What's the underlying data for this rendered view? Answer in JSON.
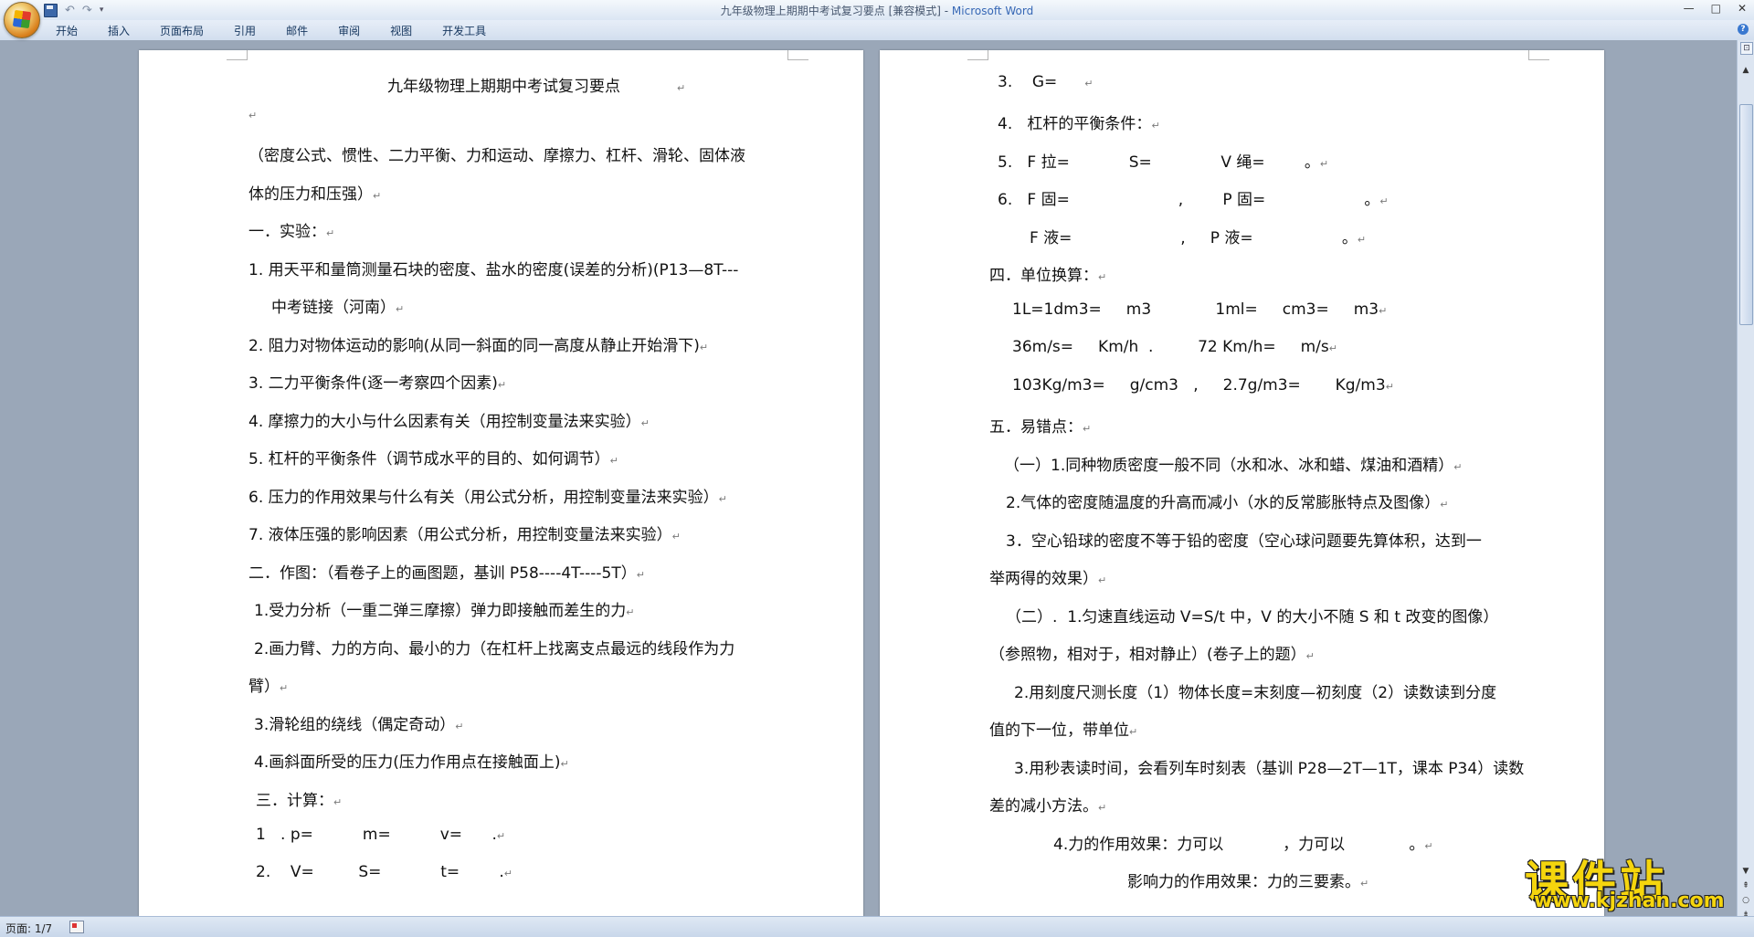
{
  "window": {
    "title_doc": "九年级物理上期期中考试复习要点 [兼容模式] - ",
    "title_app": "Microsoft Word",
    "minimize": "—",
    "maximize": "□",
    "close": "✕"
  },
  "quick_access": {
    "save_icon": "save-icon",
    "undo": "↶",
    "redo": "↷",
    "more": "▾"
  },
  "ribbon": {
    "tabs": [
      "开始",
      "插入",
      "页面布局",
      "引用",
      "邮件",
      "审阅",
      "视图",
      "开发工具"
    ],
    "help": "?"
  },
  "document": {
    "para_mark": "↵",
    "left_page": {
      "lines": [
        "九年级物理上期期中考试复习要点",
        "",
        "（密度公式、惯性、二力平衡、力和运动、摩擦力、杠杆、滑轮、固体液",
        "体的压力和压强）",
        "一．实验：",
        "1. 用天平和量筒测量石块的密度、盐水的密度(误差的分析)(P13—8T---",
        "中考链接（河南）",
        "2. 阻力对物体运动的影响(从同一斜面的同一高度从静止开始滑下)",
        "3. 二力平衡条件(逐一考察四个因素)",
        "4. 摩擦力的大小与什么因素有关（用控制变量法来实验）",
        "5. 杠杆的平衡条件（调节成水平的目的、如何调节）",
        "6. 压力的作用效果与什么有关（用公式分析，用控制变量法来实验）",
        "7. 液体压强的影响因素（用公式分析，用控制变量法来实验）",
        "二．作图：（看卷子上的画图题，基训 P58----4T----5T）",
        "1.受力分析（一重二弹三摩擦）弹力即接触而差生的力",
        "2.画力臂、力的方向、最小的力（在杠杆上找离支点最远的线段作为力",
        "臂）",
        "3.滑轮组的绕线（偶定奇动）",
        "4.画斜面所受的压力(压力作用点在接触面上)",
        "三．计算：",
        "1   . p=          m=          v=      .",
        "2.    V=         S=            t=        ."
      ]
    },
    "right_page": {
      "lines": [
        "3.    G=",
        "4.   杠杆的平衡条件：",
        "5.   F 拉=            S=              V 绳=        。",
        "6.   F 固=                      ,        P 固=                    。",
        "F 液=                      ,     P 液=                  。",
        "四．单位换算：",
        "1L=1dm3=     m3             1ml=     cm3=     m3",
        "36m/s=     Km/h  .         72 Km/h=     m/s",
        "103Kg/m3=     g/cm3   ,     2.7g/m3=       Kg/m3",
        "五．易错点：",
        "（一）1.同种物质密度一般不同（水和冰、冰和蜡、煤油和酒精）",
        "2.气体的密度随温度的升高而减小（水的反常膨胀特点及图像）",
        "3．空心铅球的密度不等于铅的密度（空心球问题要先算体积，达到一",
        "举两得的效果）",
        "（二）.  1.匀速直线运动 V=S/t 中，V 的大小不随 S 和 t 改变的图像）",
        "（参照物，相对于，相对静止）(卷子上的题）",
        "2.用刻度尺测长度（1）物体长度=末刻度—初刻度（2）读数读到分度",
        "值的下一位，带单位",
        "3.用秒表读时间，会看列车时刻表（基训 P28—2T—1T，课本 P34）读数",
        "差的减小方法。",
        "4.力的作用效果：力可以            ，力可以             。",
        "影响力的作用效果：力的三要素。"
      ]
    }
  },
  "statusbar": {
    "page_info": "页面: 1/7"
  },
  "watermark": {
    "cn": "课件站",
    "url": "www.kjzhan.com"
  }
}
